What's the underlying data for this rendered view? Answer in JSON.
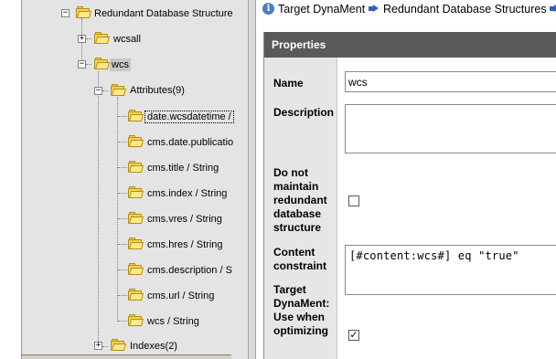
{
  "tree": {
    "root": {
      "label": "Redundant Database Structure",
      "expander": "−"
    },
    "wcsall": {
      "label": "wcsall",
      "expander": "+"
    },
    "wcs": {
      "label": "wcs",
      "expander": "−"
    },
    "attributes": {
      "label": "Attributes(9)",
      "expander": "−"
    },
    "attribute_items": [
      "date.wcsdatetime /",
      "cms.date.publicatio",
      "cms.title / String",
      "cms.index / String",
      "cms.vres / String",
      "cms.hres / String",
      "cms.description / S",
      "cms.url / String",
      "wcs / String"
    ],
    "indexes": {
      "label": "Indexes(2)",
      "expander": "+"
    }
  },
  "breadcrumb": {
    "info_glyph": "i",
    "items": [
      "Target DynaMent",
      "Redundant Database Structures"
    ]
  },
  "properties": {
    "header": "Properties",
    "name": {
      "label": "Name",
      "value": "wcs"
    },
    "description": {
      "label": "Description",
      "value": ""
    },
    "do_not_maintain": {
      "label": "Do not maintain redundant database structure",
      "checked": false,
      "mark": ""
    },
    "content_constraint": {
      "label": "Content constraint",
      "value": "[#content:wcs#] eq \"true\""
    },
    "target_dynament": {
      "label": "Target DynaMent: Use when optimizing",
      "checked": true,
      "mark": "✓"
    }
  },
  "colors": {
    "header_bg": "#5a5a5a",
    "label_col_bg": "#e6e6e6",
    "tree_bg": "#e4e4e4",
    "folder": "#f7d44a",
    "crumb_arrow": "#2a62c8"
  }
}
